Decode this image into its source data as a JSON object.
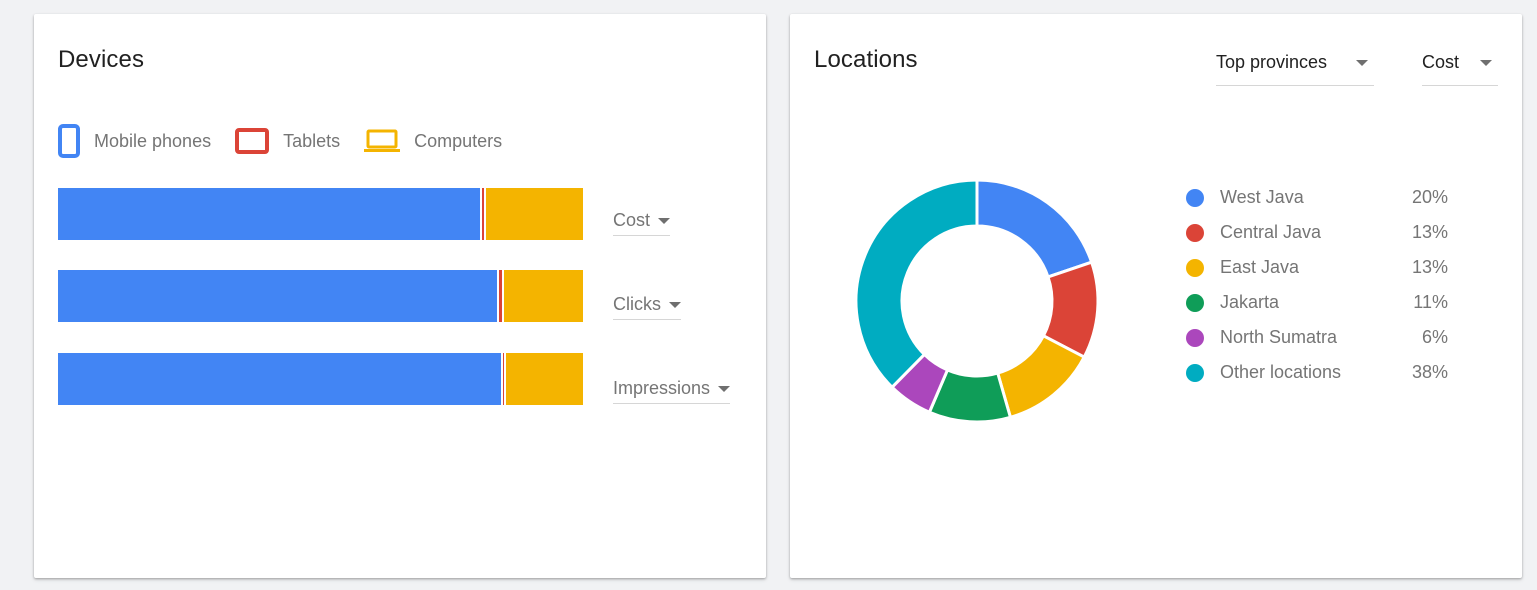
{
  "devices": {
    "title": "Devices",
    "legend": [
      {
        "key": "mobile",
        "label": "Mobile phones",
        "icon": "smartphone-icon",
        "color": "#4285f4"
      },
      {
        "key": "tablet",
        "label": "Tablets",
        "icon": "tablet-icon",
        "color": "#db4437"
      },
      {
        "key": "computer",
        "label": "Computers",
        "icon": "laptop-icon",
        "color": "#f4b400"
      }
    ],
    "rows": [
      {
        "metric_label": "Cost",
        "shares": {
          "mobile": 80.4,
          "tablet": 0.8,
          "computer": 18.8
        }
      },
      {
        "metric_label": "Clicks",
        "shares": {
          "mobile": 83.6,
          "tablet": 0.9,
          "computer": 15.5
        }
      },
      {
        "metric_label": "Impressions",
        "shares": {
          "mobile": 84.4,
          "tablet": 0.5,
          "computer": 15.1
        }
      }
    ]
  },
  "locations": {
    "title": "Locations",
    "region_select": "Top provinces",
    "metric_select": "Cost",
    "items": [
      {
        "name": "West Java",
        "value": "20%",
        "color": "#4285f4"
      },
      {
        "name": "Central Java",
        "value": "13%",
        "color": "#db4437"
      },
      {
        "name": "East Java",
        "value": "13%",
        "color": "#f4b400"
      },
      {
        "name": "Jakarta",
        "value": "11%",
        "color": "#0f9d58"
      },
      {
        "name": "North Sumatra",
        "value": "6%",
        "color": "#ab47bc"
      },
      {
        "name": "Other locations",
        "value": "38%",
        "color": "#00acc1"
      }
    ]
  },
  "chart_data": [
    {
      "type": "bar",
      "orientation": "horizontal-stacked-100",
      "title": "Devices",
      "categories": [
        "Cost",
        "Clicks",
        "Impressions"
      ],
      "series": [
        {
          "name": "Mobile phones",
          "values": [
            80.4,
            83.6,
            84.4
          ]
        },
        {
          "name": "Tablets",
          "values": [
            0.8,
            0.9,
            0.5
          ]
        },
        {
          "name": "Computers",
          "values": [
            18.8,
            15.5,
            15.1
          ]
        }
      ],
      "unit": "%",
      "legend": "top"
    },
    {
      "type": "pie",
      "variant": "donut",
      "title": "Locations",
      "categories": [
        "West Java",
        "Central Java",
        "East Java",
        "Jakarta",
        "North Sumatra",
        "Other locations"
      ],
      "values": [
        20,
        13,
        13,
        11,
        6,
        38
      ],
      "unit": "%",
      "legend": "right"
    }
  ]
}
